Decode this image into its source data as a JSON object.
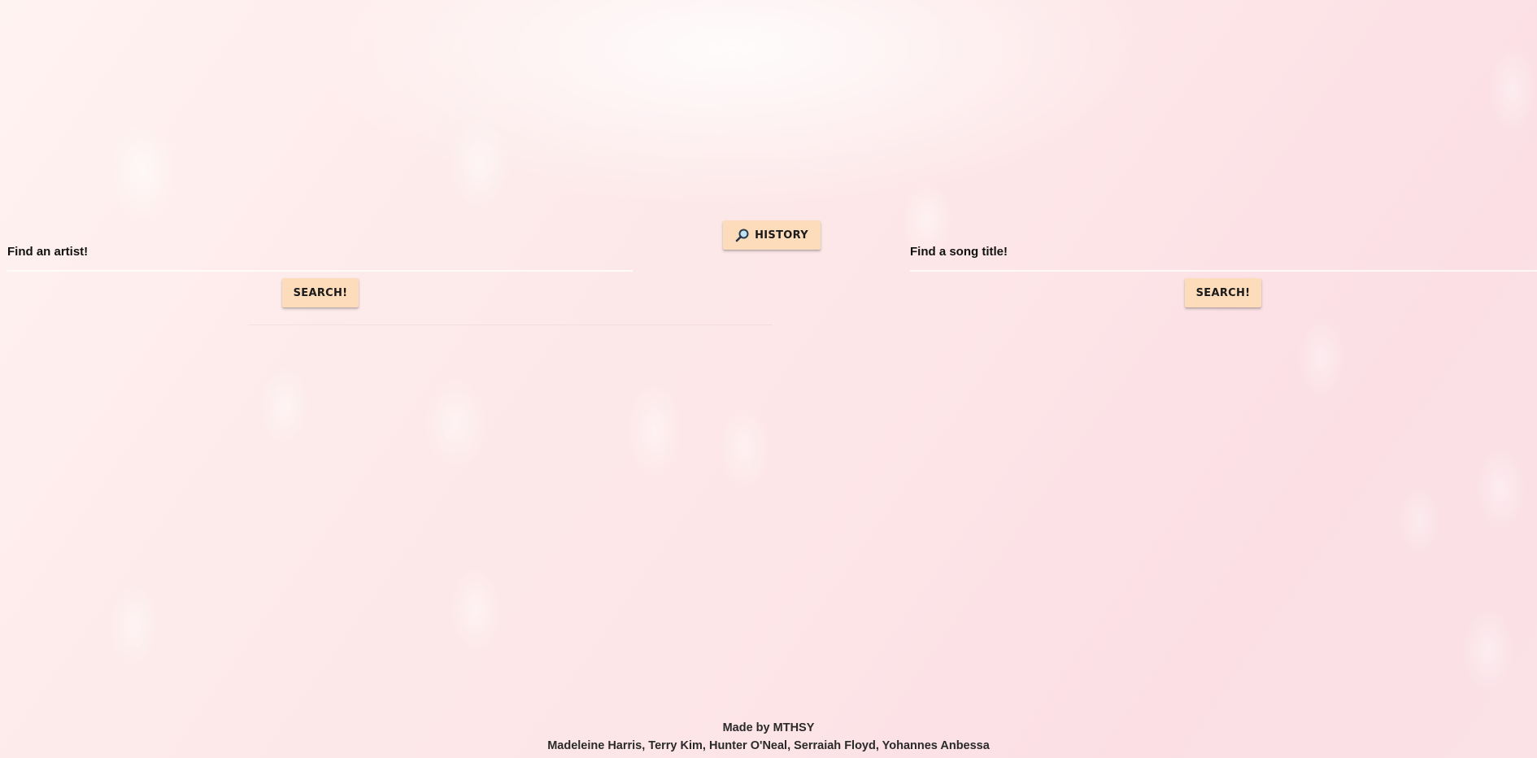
{
  "history_button": {
    "label": "HISTORY",
    "icon": "magnifier-icon"
  },
  "artist_search": {
    "label": "Find an artist!",
    "button_label": "SEARCH!"
  },
  "song_search": {
    "label": "Find a song title!",
    "button_label": "SEARCH!"
  },
  "footer": {
    "credit": "Made by MTHSY",
    "names": "Madeleine Harris, Terry Kim, Hunter O'Neal, Serraiah Floyd, Yohannes Anbessa"
  },
  "colors": {
    "button_bg": "#fddcbb",
    "text": "#111111"
  }
}
